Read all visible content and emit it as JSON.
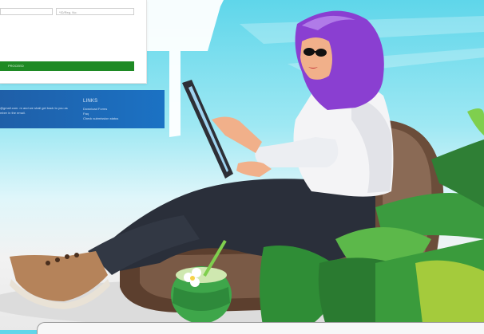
{
  "form": {
    "field1_placeholder": "",
    "field2_placeholder": "*ID/Reg. No:",
    "proceed_label": "PROCEED"
  },
  "footer": {
    "contact_text_line1": "@gmail.com. m and we shall get back to you as",
    "contact_text_line2": "mber in the email.",
    "links_title": "LINKS",
    "links": [
      "Download Forms",
      "Faq",
      "Check submission status"
    ]
  },
  "colors": {
    "proceed": "#1e8a24",
    "footer_band": "#1b72c4",
    "hijab": "#8a3fd1",
    "sky": "#5fd6ea"
  },
  "illustration": {
    "subject": "woman-in-hijab-with-tablet-on-chair",
    "items": [
      "sunglasses-icon",
      "tablet-icon",
      "coconut-drink-icon",
      "palm-leaves-icon",
      "frangipani-flower-icon"
    ]
  }
}
